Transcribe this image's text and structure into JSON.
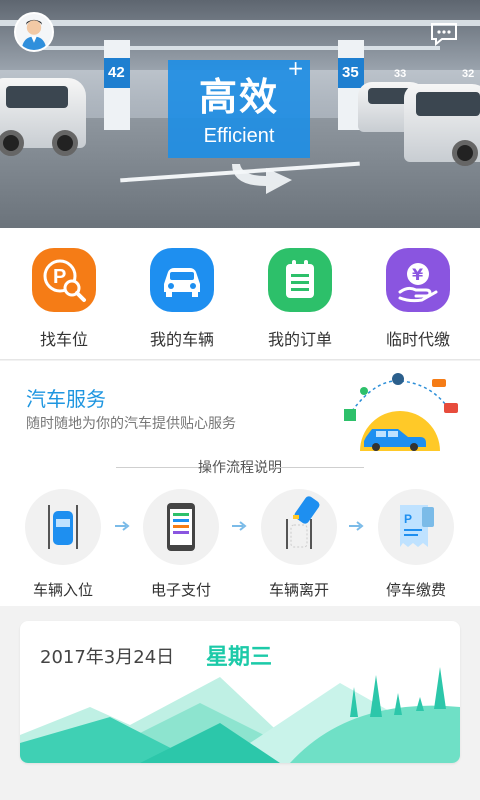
{
  "hero": {
    "badge_big": "高效",
    "badge_small": "Efficient",
    "badge_plus": "+",
    "pillars": [
      "42",
      "35",
      "33",
      "32"
    ]
  },
  "quick_menu": [
    {
      "label": "找车位",
      "icon": "find-parking-icon",
      "color": "#f57c16"
    },
    {
      "label": "我的车辆",
      "icon": "car-icon",
      "color": "#1e8ff0"
    },
    {
      "label": "我的订单",
      "icon": "order-list-icon",
      "color": "#2dc06a"
    },
    {
      "label": "临时代缴",
      "icon": "yuan-pay-icon",
      "color": "#8a55e0"
    }
  ],
  "service": {
    "title": "汽车服务",
    "subtitle": "随时随地为你的汽车提供贴心服务",
    "flow_title": "操作流程说明",
    "steps": [
      {
        "label": "车辆入位",
        "icon": "car-parking-icon"
      },
      {
        "label": "电子支付",
        "icon": "phone-pay-icon"
      },
      {
        "label": "车辆离开",
        "icon": "car-leave-icon"
      },
      {
        "label": "停车缴费",
        "icon": "parking-bill-icon"
      }
    ]
  },
  "date_card": {
    "date": "2017年3月24日",
    "weekday": "星期三"
  },
  "colors": {
    "accent_blue": "#1e96e0",
    "teal": "#1ccaa8"
  }
}
